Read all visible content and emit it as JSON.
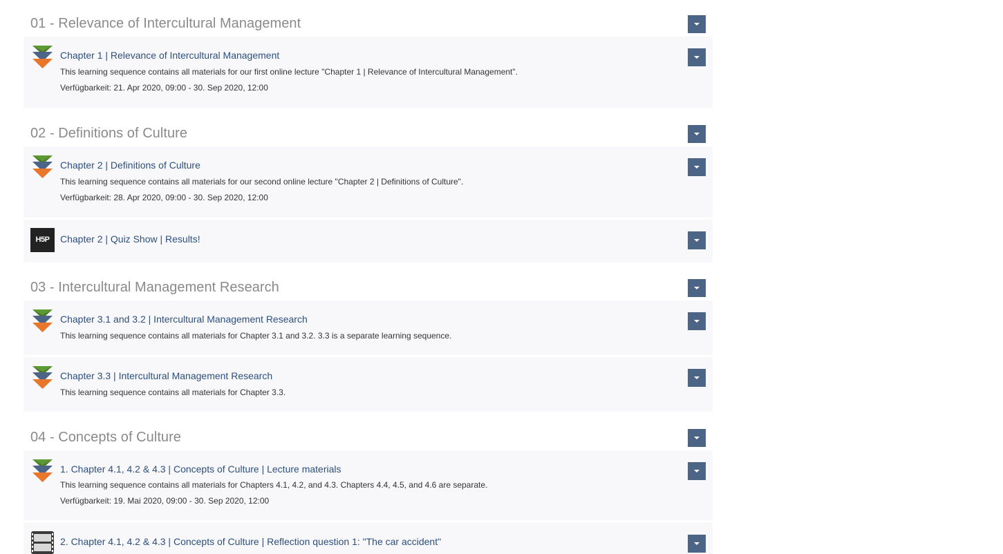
{
  "colors": {
    "section_title": "#8a8a8a",
    "item_title": "#2c4f7d",
    "item_text": "#333333",
    "item_background": "#f8f8fa",
    "dropdown_button": "#4c6586"
  },
  "sections": [
    {
      "title": "01 - Relevance of Intercultural Management",
      "items": [
        {
          "icon": "learning-sequence-icon",
          "title": "Chapter 1 | Relevance of Intercultural Management",
          "description": "This learning sequence contains all materials for our first online lecture \"Chapter 1 | Relevance of Intercultural Management\".",
          "availability": "Verfügbarkeit: 21. Apr 2020, 09:00 - 30. Sep 2020, 12:00"
        }
      ]
    },
    {
      "title": "02 - Definitions of Culture",
      "items": [
        {
          "icon": "learning-sequence-icon",
          "title": "Chapter 2 | Definitions of Culture",
          "description": "This learning sequence contains all materials for our second online lecture \"Chapter 2 | Definitions of Culture\".",
          "availability": "Verfügbarkeit: 28. Apr 2020, 09:00 - 30. Sep 2020, 12:00"
        },
        {
          "icon": "h5p-icon",
          "icon_text": "H5P",
          "title": "Chapter 2 | Quiz Show | Results!"
        }
      ]
    },
    {
      "title": "03 - Intercultural Management Research",
      "items": [
        {
          "icon": "learning-sequence-icon",
          "title": "Chapter 3.1 and 3.2 | Intercultural Management Research",
          "description": "This learning sequence contains all materials for Chapter 3.1 and 3.2. 3.3 is a separate learning sequence."
        },
        {
          "icon": "learning-sequence-icon",
          "title": "Chapter 3.3 | Intercultural Management Research",
          "description": "This learning sequence contains all materials for Chapter 3.3."
        }
      ]
    },
    {
      "title": "04 - Concepts of Culture",
      "items": [
        {
          "icon": "learning-sequence-icon",
          "title": "1. Chapter 4.1, 4.2 & 4.3 | Concepts of Culture | Lecture materials",
          "description": "This learning sequence contains all materials for Chapters 4.1, 4.2, and 4.3. Chapters 4.4, 4.5, and 4.6 are separate.",
          "availability": "Verfügbarkeit: 19. Mai 2020, 09:00 - 30. Sep 2020, 12:00"
        },
        {
          "icon": "film-icon",
          "title": "2. Chapter 4.1, 4.2 & 4.3 | Concepts of Culture | Reflection question 1: \"The car accident\""
        }
      ]
    }
  ]
}
